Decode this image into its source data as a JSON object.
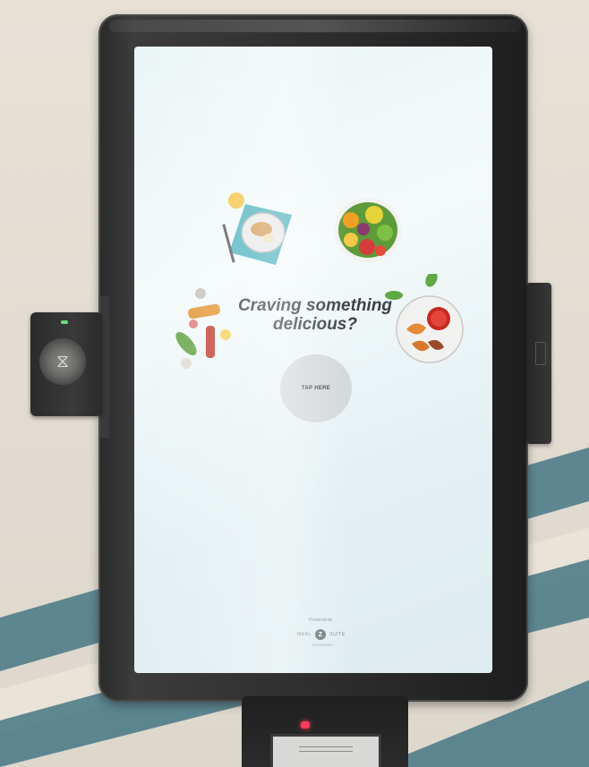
{
  "screen": {
    "headline_line1": "Craving something",
    "headline_line2": "delicious?",
    "tap_button_label": "TAP HERE",
    "powered_by": "Powered by",
    "brand_left": "MEAL",
    "brand_right": "SUITE",
    "brand_sub": "GRUBBRRR"
  },
  "food_images": [
    "breakfast-plate-icon",
    "fruit-platter-icon",
    "drinks-sauces-icon",
    "shrimp-dip-icon"
  ],
  "devices": [
    "nfc-card-reader",
    "side-scanner",
    "receipt-printer"
  ],
  "colors": {
    "screen_bg": "#eaf4f6",
    "headline": "#3a4148",
    "tap_button": "#d4d9dc",
    "printer_led": "#ff3a5a",
    "reader_led": "#6bdc7b",
    "wall_stripe": "#4f7c88"
  }
}
